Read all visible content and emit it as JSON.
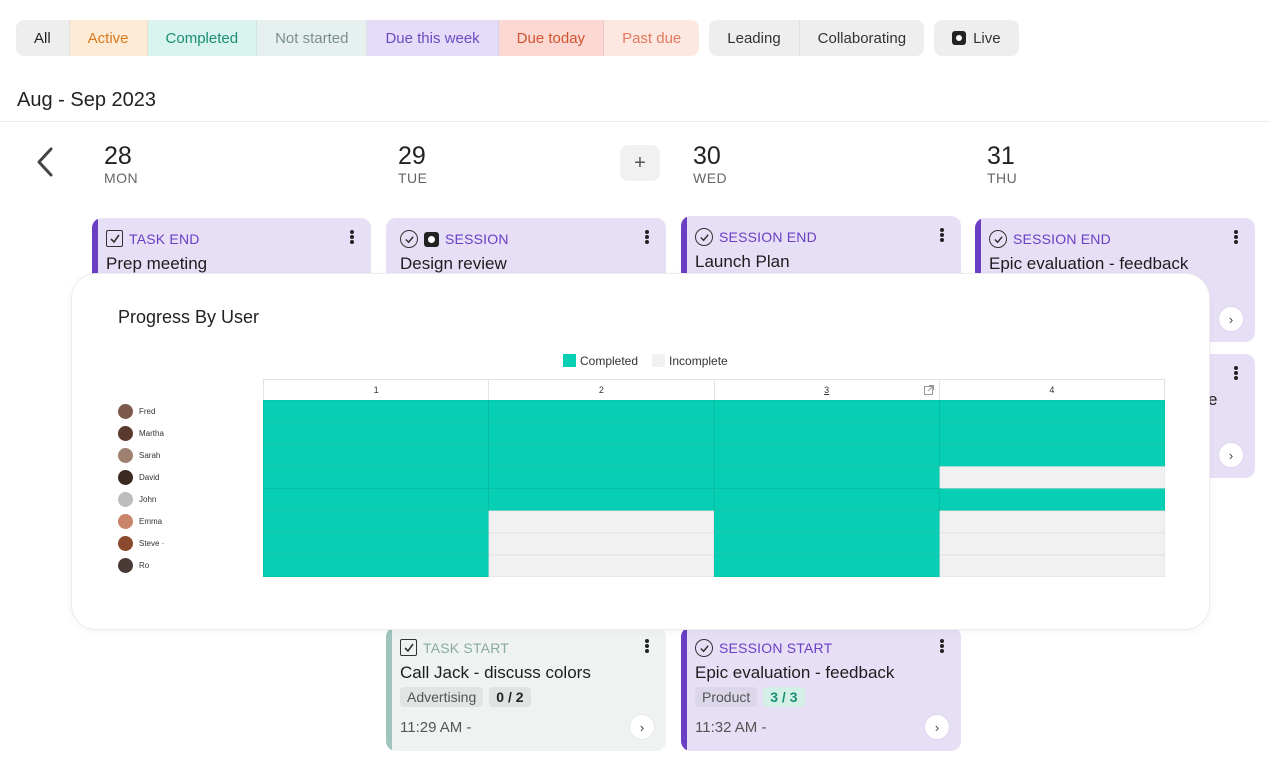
{
  "filters": {
    "status": [
      {
        "label": "All",
        "bg": "#eeeeee",
        "fg": "#222222"
      },
      {
        "label": "Active",
        "bg": "#fdebd6",
        "fg": "#d97a1e"
      },
      {
        "label": "Completed",
        "bg": "#d9f4ee",
        "fg": "#1a8f74"
      },
      {
        "label": "Not started",
        "bg": "#e6f1ef",
        "fg": "#7a8f8b"
      },
      {
        "label": "Due this week",
        "bg": "#e4dcf8",
        "fg": "#6c4bc2"
      },
      {
        "label": "Due today",
        "bg": "#fbd9d2",
        "fg": "#d2532f"
      },
      {
        "label": "Past due",
        "bg": "#fde8e1",
        "fg": "#e17a5e"
      }
    ],
    "role": [
      {
        "label": "Leading",
        "bg": "#eeeeee",
        "fg": "#333333"
      },
      {
        "label": "Collaborating",
        "bg": "#eeeeee",
        "fg": "#333333"
      }
    ],
    "live": {
      "label": "Live",
      "bg": "#eeeeee",
      "fg": "#333333"
    }
  },
  "range_title": "Aug - Sep 2023",
  "days": [
    {
      "num": "28",
      "name": "MON"
    },
    {
      "num": "29",
      "name": "TUE"
    },
    {
      "num": "30",
      "name": "WED"
    },
    {
      "num": "31",
      "name": "THU"
    }
  ],
  "add_label": "+",
  "cards": {
    "c1": {
      "type": "TASK END",
      "title": "Prep meeting"
    },
    "c2": {
      "type": "SESSION",
      "title": "Design review"
    },
    "c3": {
      "type": "SESSION END",
      "title": "Launch Plan"
    },
    "c4": {
      "type": "SESSION END",
      "title": "Epic evaluation - feedback"
    },
    "c5": {
      "partial_text": "e"
    },
    "c6": {
      "type": "TASK START",
      "title": "Call Jack - discuss colors",
      "tag": "Advertising",
      "count": "0 / 2",
      "time": "11:29 AM -"
    },
    "c7": {
      "type": "SESSION START",
      "title": "Epic evaluation - feedback",
      "tag": "Product",
      "count": "3 / 3",
      "time": "11:32 AM -"
    }
  },
  "colors": {
    "purple_bar": "#6a3fc4",
    "purple_bg": "#e7dff6",
    "purple_text": "#6a3fc4",
    "teal_bar": "#9fc4bd",
    "teal_bg": "#eef3f2",
    "teal_text": "#8aa9a3",
    "completed": "#07cfb3",
    "incomplete": "#f1f1f1"
  },
  "overlay": {
    "title": "Progress By User",
    "legend": {
      "completed": "Completed",
      "incomplete": "Incomplete"
    }
  },
  "chart_data": {
    "type": "heatmap",
    "title": "Progress By User",
    "columns": [
      "1",
      "2",
      "3",
      "4"
    ],
    "rows": [
      {
        "name": "Fred",
        "avatar_color": "#7c5a4a",
        "values": [
          1,
          1,
          1,
          1
        ]
      },
      {
        "name": "Martha",
        "avatar_color": "#5b3a2e",
        "values": [
          1,
          1,
          1,
          1
        ]
      },
      {
        "name": "Sarah",
        "avatar_color": "#a08070",
        "values": [
          1,
          1,
          1,
          1
        ]
      },
      {
        "name": "David",
        "avatar_color": "#3a2a22",
        "values": [
          1,
          1,
          1,
          0
        ]
      },
      {
        "name": "John",
        "avatar_color": "#bdbdbd",
        "values": [
          1,
          1,
          1,
          1
        ]
      },
      {
        "name": "Emma",
        "avatar_color": "#c9846a",
        "values": [
          1,
          0,
          1,
          0
        ]
      },
      {
        "name": "Steve ·",
        "avatar_color": "#8a4a2e",
        "values": [
          1,
          0,
          1,
          0
        ]
      },
      {
        "name": "Ro",
        "avatar_color": "#4a3a36",
        "values": [
          1,
          0,
          1,
          0
        ]
      }
    ],
    "legend": [
      "Completed",
      "Incomplete"
    ]
  }
}
